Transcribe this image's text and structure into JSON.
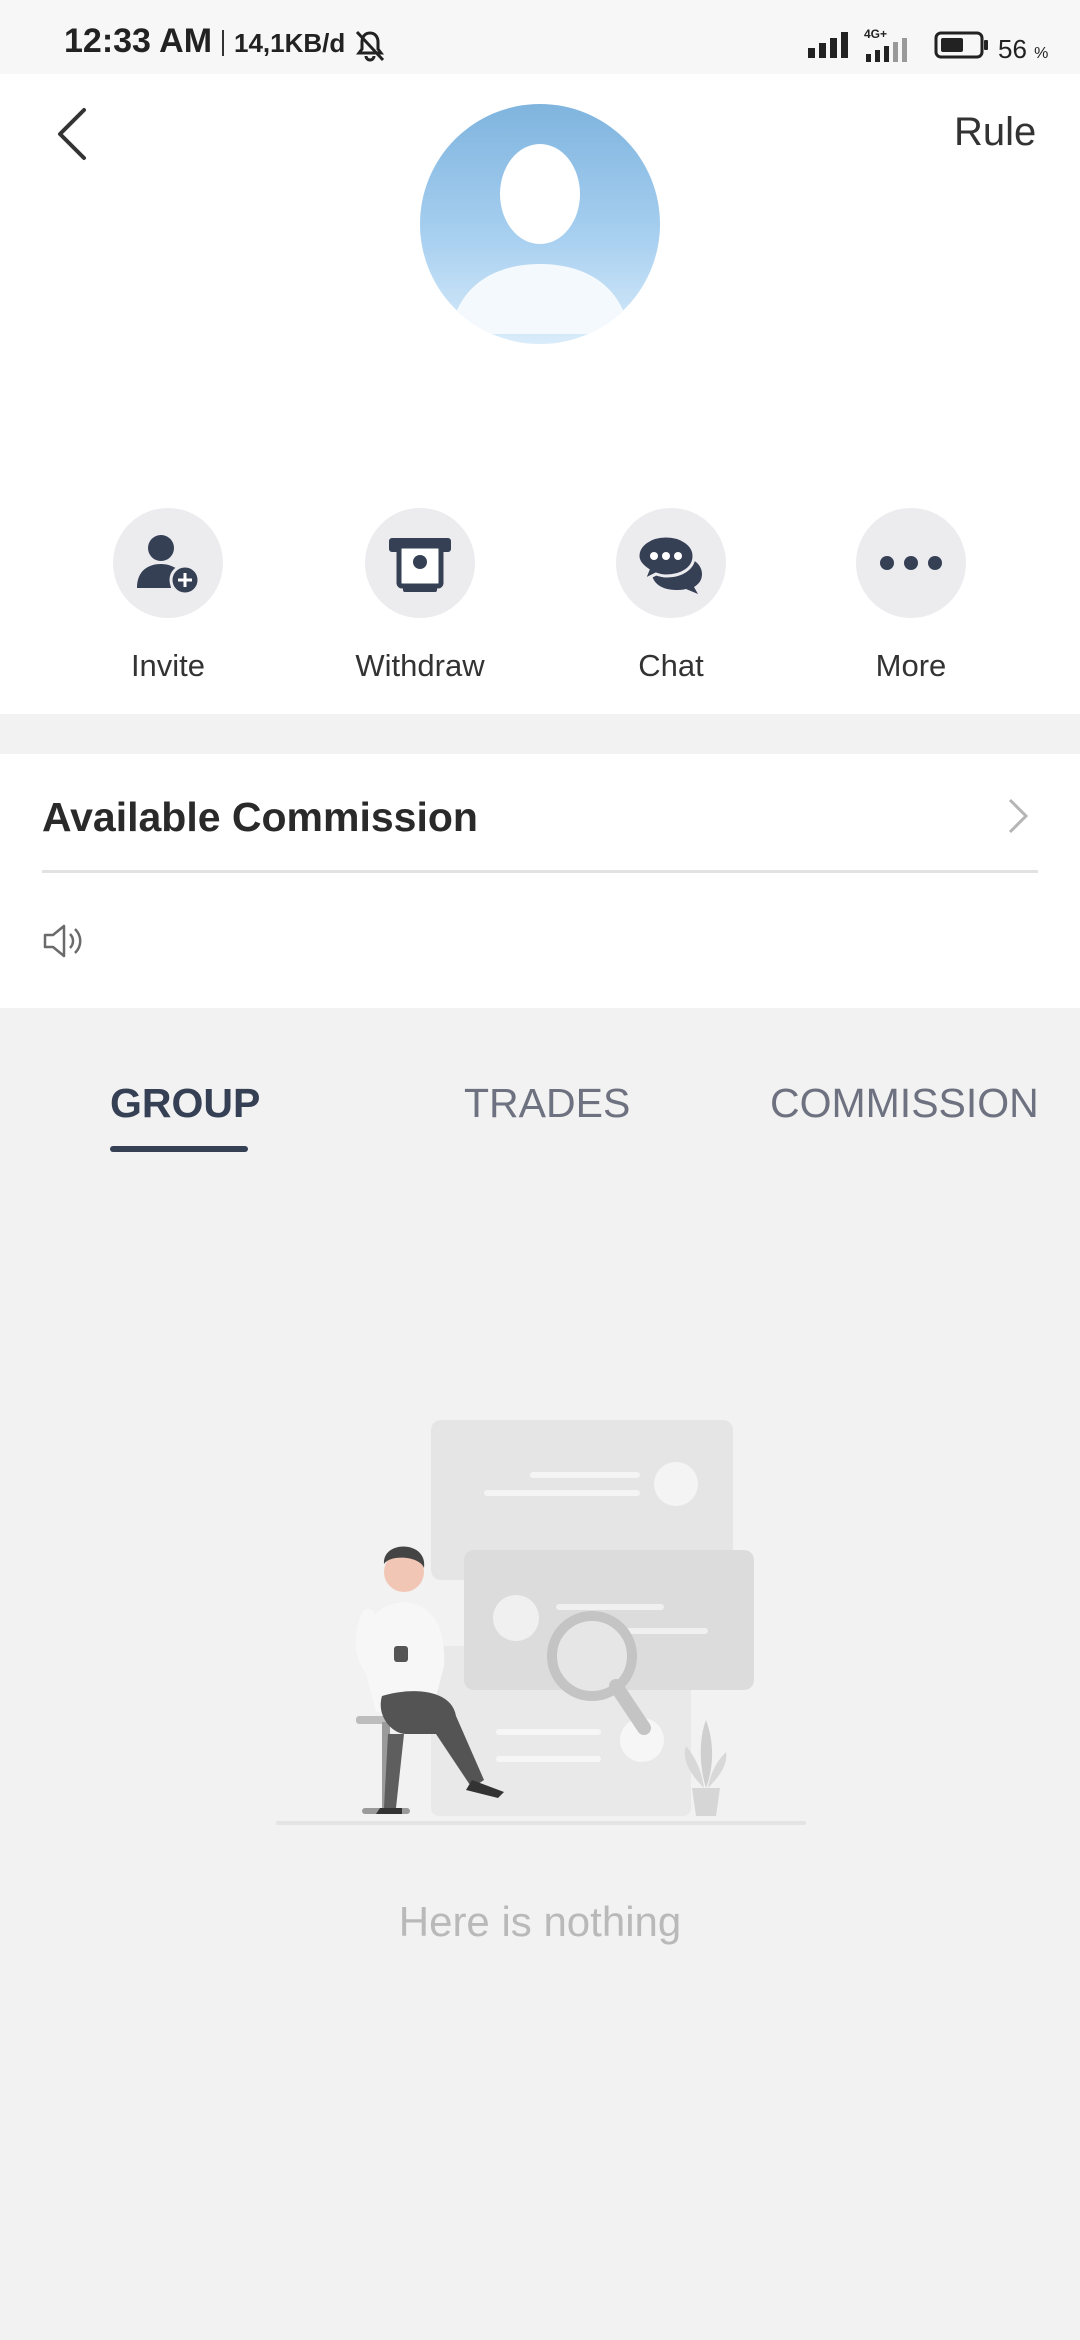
{
  "status_bar": {
    "time": "12:33 AM",
    "speed": "14,1KB/d",
    "network": "4G+",
    "battery": "56",
    "battery_unit": "%"
  },
  "header": {
    "back_icon": "chevron-left-icon",
    "rule_label": "Rule"
  },
  "actions": [
    {
      "label": "Invite",
      "icon": "add-user-icon"
    },
    {
      "label": "Withdraw",
      "icon": "atm-withdraw-icon"
    },
    {
      "label": "Chat",
      "icon": "chat-bubbles-icon"
    },
    {
      "label": "More",
      "icon": "more-dots-icon"
    }
  ],
  "commission": {
    "title": "Available Commission",
    "notice_icon": "speaker-icon"
  },
  "tabs": [
    {
      "label": "GROUP",
      "active": true
    },
    {
      "label": "TRADES",
      "active": false
    },
    {
      "label": "COMMISSION",
      "active": false
    }
  ],
  "empty_state": {
    "text": "Here is nothing"
  },
  "colors": {
    "accent": "#364055",
    "background": "#f2f2f2",
    "icon_circle": "#ececef"
  }
}
